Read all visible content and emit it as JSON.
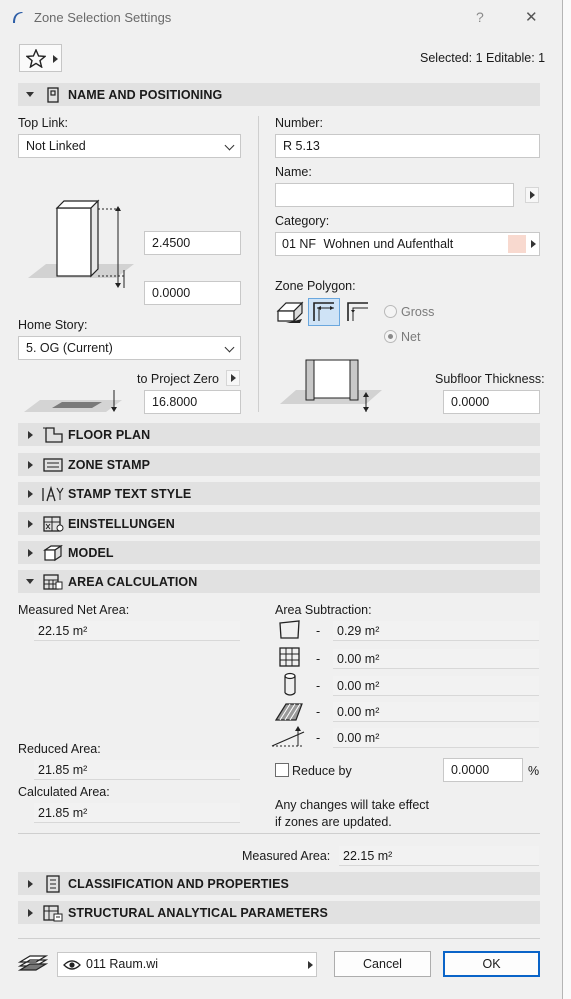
{
  "window": {
    "title": "Zone Selection Settings",
    "help": "?",
    "close": "✕"
  },
  "toolbar": {
    "selection_info": "Selected: 1 Editable: 1"
  },
  "sections": {
    "name_positioning": "NAME AND POSITIONING",
    "floor_plan": "FLOOR PLAN",
    "zone_stamp": "ZONE STAMP",
    "stamp_text_style": "STAMP TEXT STYLE",
    "einstellungen": "EINSTELLUNGEN",
    "model": "MODEL",
    "area_calculation": "AREA CALCULATION",
    "classification": "CLASSIFICATION AND PROPERTIES",
    "structural": "STRUCTURAL ANALYTICAL PARAMETERS"
  },
  "name_positioning": {
    "top_link_label": "Top Link:",
    "top_link_value": "Not Linked",
    "height_value": "2.4500",
    "offset_value": "0.0000",
    "home_story_label": "Home Story:",
    "home_story_value": "5. OG (Current)",
    "to_project_zero_label": "to Project Zero",
    "project_zero_value": "16.8000",
    "number_label": "Number:",
    "number_value": "R 5.13",
    "name_label": "Name:",
    "name_value": "",
    "category_label": "Category:",
    "category_code": "01 NF",
    "category_name": "Wohnen und Aufenthalt",
    "category_color": "#f8d9cf",
    "zone_polygon_label": "Zone Polygon:",
    "gross_label": "Gross",
    "net_label": "Net",
    "subfloor_label": "Subfloor Thickness:",
    "subfloor_value": "0.0000"
  },
  "area_calculation": {
    "measured_net_label": "Measured Net Area:",
    "measured_net_value": "22.15 m²",
    "reduced_label": "Reduced Area:",
    "reduced_value": "21.85 m²",
    "calculated_label": "Calculated Area:",
    "calculated_value": "21.85 m²",
    "subtraction_label": "Area Subtraction:",
    "subtractions": [
      "0.29 m²",
      "0.00 m²",
      "0.00 m²",
      "0.00 m²",
      "0.00 m²"
    ],
    "dash": "-",
    "reduce_by_label": "Reduce by",
    "reduce_by_value": "0.0000",
    "percent": "%",
    "note_line1": "Any changes will take effect",
    "note_line2": "if zones are updated.",
    "measured_area_label": "Measured Area:",
    "measured_area_value": "22.15 m²"
  },
  "footer": {
    "layer": "011 Raum.wi",
    "cancel": "Cancel",
    "ok": "OK"
  }
}
